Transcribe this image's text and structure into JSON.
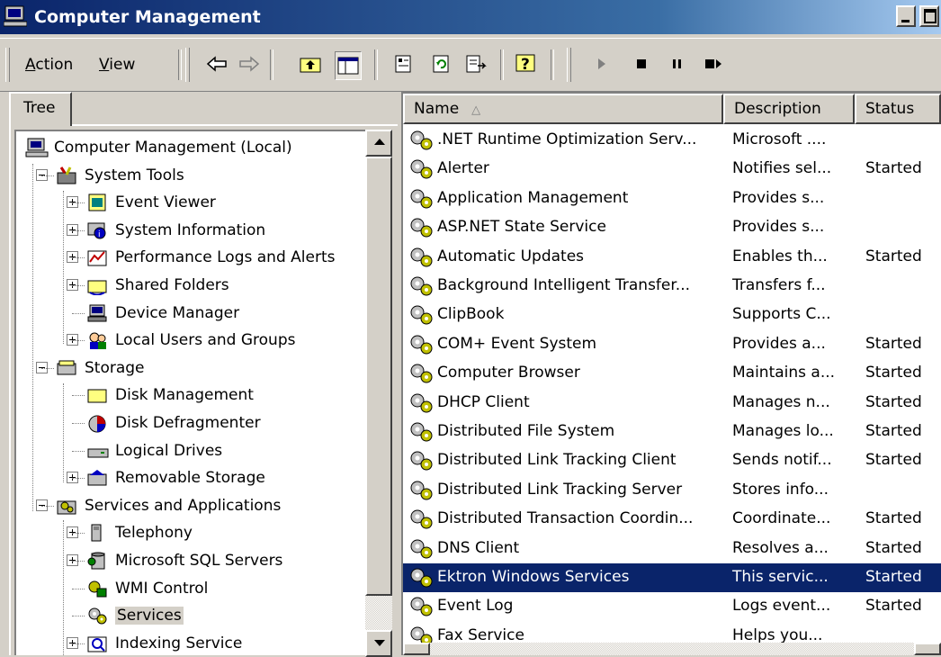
{
  "window": {
    "title": "Computer Management"
  },
  "menu": {
    "action": "Action",
    "action_key": "A",
    "action_rest": "ction",
    "view": "View",
    "view_key": "V",
    "view_rest": "iew"
  },
  "toolbar": {
    "icons": [
      "back-arrow-icon",
      "forward-arrow-icon",
      "up-folder-icon",
      "show-hide-tree-icon",
      "properties-icon",
      "refresh-icon",
      "export-list-icon",
      "help-icon",
      "start-service-icon",
      "stop-service-icon",
      "pause-service-icon",
      "restart-service-icon"
    ]
  },
  "tree_tab": {
    "label": "Tree"
  },
  "tree": [
    {
      "label": "Computer Management (Local)",
      "level": 0,
      "icon": "computer-icon"
    },
    {
      "label": "System Tools",
      "level": 1,
      "icon": "system-tools-icon",
      "expander": "minus"
    },
    {
      "label": "Event Viewer",
      "level": 2,
      "icon": "event-viewer-icon",
      "expander": "plus"
    },
    {
      "label": "System Information",
      "level": 2,
      "icon": "system-info-icon",
      "expander": "plus"
    },
    {
      "label": "Performance Logs and Alerts",
      "level": 2,
      "icon": "performance-icon",
      "expander": "plus"
    },
    {
      "label": "Shared Folders",
      "level": 2,
      "icon": "shared-folders-icon",
      "expander": "plus"
    },
    {
      "label": "Device Manager",
      "level": 2,
      "icon": "device-manager-icon"
    },
    {
      "label": "Local Users and Groups",
      "level": 2,
      "icon": "users-groups-icon",
      "expander": "plus"
    },
    {
      "label": "Storage",
      "level": 1,
      "icon": "storage-icon",
      "expander": "minus"
    },
    {
      "label": "Disk Management",
      "level": 2,
      "icon": "disk-management-icon"
    },
    {
      "label": "Disk Defragmenter",
      "level": 2,
      "icon": "defragmenter-icon"
    },
    {
      "label": "Logical Drives",
      "level": 2,
      "icon": "logical-drives-icon"
    },
    {
      "label": "Removable Storage",
      "level": 2,
      "icon": "removable-storage-icon",
      "expander": "plus"
    },
    {
      "label": "Services and Applications",
      "level": 1,
      "icon": "services-apps-icon",
      "expander": "minus"
    },
    {
      "label": "Telephony",
      "level": 2,
      "icon": "telephony-icon",
      "expander": "plus"
    },
    {
      "label": "Microsoft SQL Servers",
      "level": 2,
      "icon": "sql-servers-icon",
      "expander": "plus"
    },
    {
      "label": "WMI Control",
      "level": 2,
      "icon": "wmi-control-icon"
    },
    {
      "label": "Services",
      "level": 2,
      "icon": "services-icon",
      "selected": true
    },
    {
      "label": "Indexing Service",
      "level": 2,
      "icon": "indexing-service-icon",
      "expander": "plus"
    }
  ],
  "columns": {
    "name": "Name",
    "sort_indicator": "△",
    "description": "Description",
    "status": "Status"
  },
  "services": [
    {
      "name": ".NET Runtime Optimization Serv...",
      "description": "Microsoft ....",
      "status": ""
    },
    {
      "name": "Alerter",
      "description": "Notifies sel...",
      "status": "Started"
    },
    {
      "name": "Application Management",
      "description": "Provides s...",
      "status": ""
    },
    {
      "name": "ASP.NET State Service",
      "description": "Provides s...",
      "status": ""
    },
    {
      "name": "Automatic Updates",
      "description": "Enables th...",
      "status": "Started"
    },
    {
      "name": "Background Intelligent Transfer...",
      "description": "Transfers f...",
      "status": ""
    },
    {
      "name": "ClipBook",
      "description": "Supports C...",
      "status": ""
    },
    {
      "name": "COM+ Event System",
      "description": "Provides a...",
      "status": "Started"
    },
    {
      "name": "Computer Browser",
      "description": "Maintains a...",
      "status": "Started"
    },
    {
      "name": "DHCP Client",
      "description": "Manages n...",
      "status": "Started"
    },
    {
      "name": "Distributed File System",
      "description": "Manages lo...",
      "status": "Started"
    },
    {
      "name": "Distributed Link Tracking Client",
      "description": "Sends notif...",
      "status": "Started"
    },
    {
      "name": "Distributed Link Tracking Server",
      "description": "Stores info...",
      "status": ""
    },
    {
      "name": "Distributed Transaction Coordin...",
      "description": "Coordinate...",
      "status": "Started"
    },
    {
      "name": "DNS Client",
      "description": "Resolves a...",
      "status": "Started"
    },
    {
      "name": "Ektron Windows Services",
      "description": "This servic...",
      "status": "Started",
      "selected": true
    },
    {
      "name": "Event Log",
      "description": "Logs event...",
      "status": "Started"
    },
    {
      "name": "Fax Service",
      "description": "Helps you...",
      "status": ""
    }
  ],
  "colors": {
    "selection": "#0a246a",
    "face": "#d4d0c8",
    "title_start": "#0a246a",
    "title_end": "#a6caf0"
  }
}
